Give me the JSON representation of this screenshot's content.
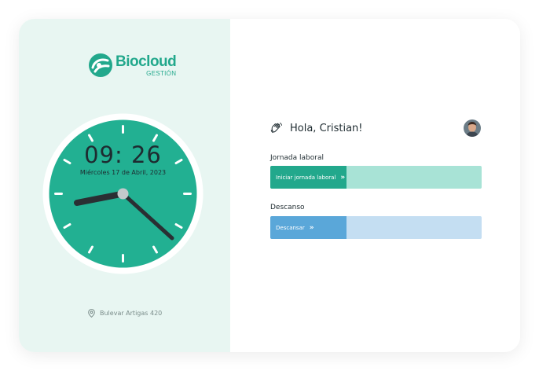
{
  "brand": {
    "name": "Biocloud",
    "subtitle": "GESTIÓN",
    "color": "#22a88c"
  },
  "clock": {
    "time": "09: 26",
    "date": "Miércoles 17 de Abril, 2023",
    "face_color": "#22b092",
    "hands_color": "#2a2f33"
  },
  "location": {
    "icon": "map-pin-icon",
    "address": "Bulevar Artigas 420"
  },
  "greeting": {
    "icon": "waving-hand-icon",
    "text": "Hola, Cristian!"
  },
  "user": {
    "avatar": "user-avatar"
  },
  "work": {
    "label": "Jornada laboral",
    "button_label": "Iniciar jornada laboral",
    "button_icon": "double-chevron-right-icon",
    "colors": {
      "button": "#22a88c",
      "track": "#a8e3d6"
    }
  },
  "rest": {
    "label": "Descanso",
    "button_label": "Descansar",
    "button_icon": "double-chevron-right-icon",
    "colors": {
      "button": "#5aa7d9",
      "track": "#c4def2"
    }
  }
}
